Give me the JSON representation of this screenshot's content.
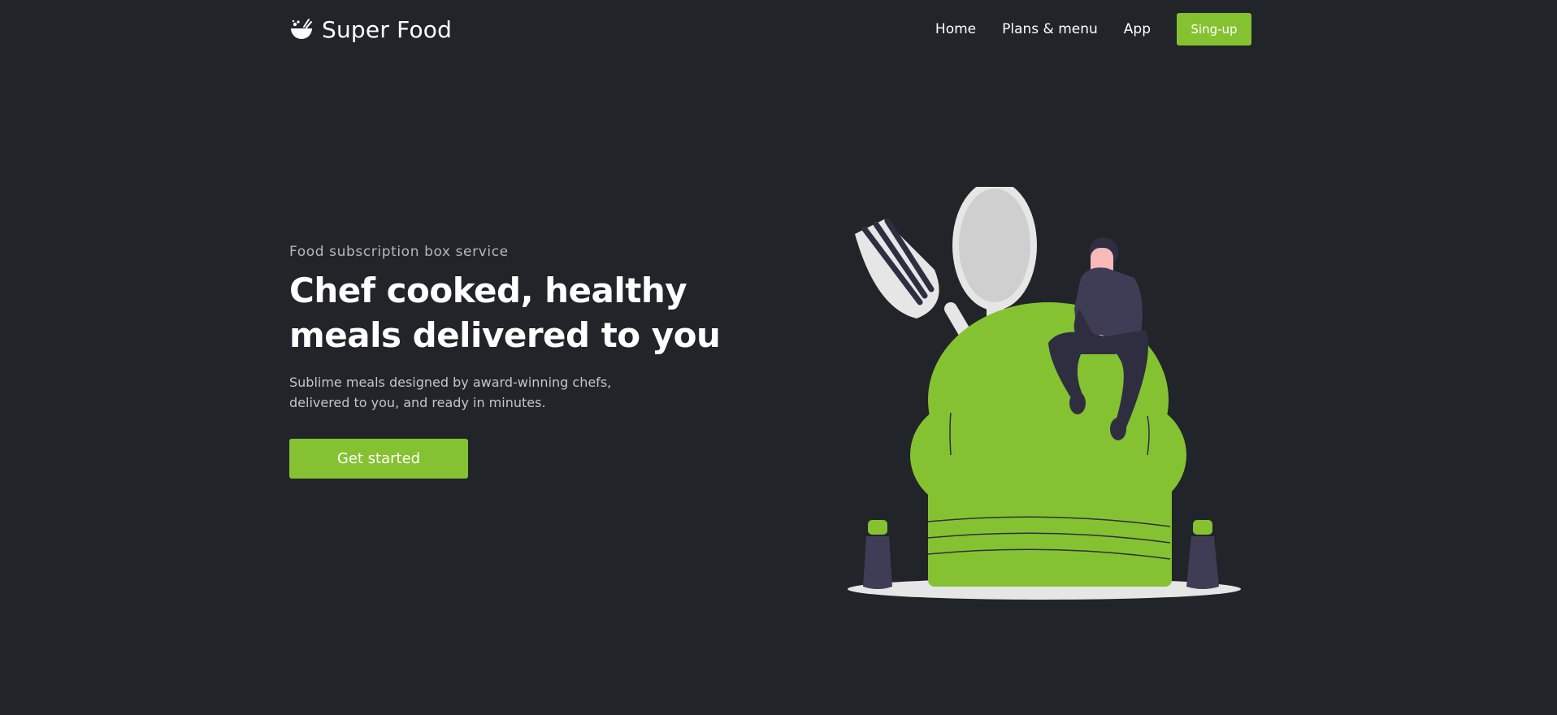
{
  "nav": {
    "brand": "Super Food",
    "brand_icon": "bowl-icon",
    "links": [
      "Home",
      "Plans & menu",
      "App"
    ],
    "signup_label": "Sing-up"
  },
  "hero": {
    "eyebrow": "Food subscription box service",
    "headline_line1": "Chef cooked, healthy",
    "headline_line2": "meals delivered to you",
    "subtext_line1": "Sublime meals designed by award-winning chefs,",
    "subtext_line2": "delivered to you, and ready in minutes.",
    "cta_label": "Get started"
  },
  "colors": {
    "background": "#212428",
    "accent": "#85c232",
    "text": "#ffffff",
    "muted_text": "#b4b8bd"
  }
}
